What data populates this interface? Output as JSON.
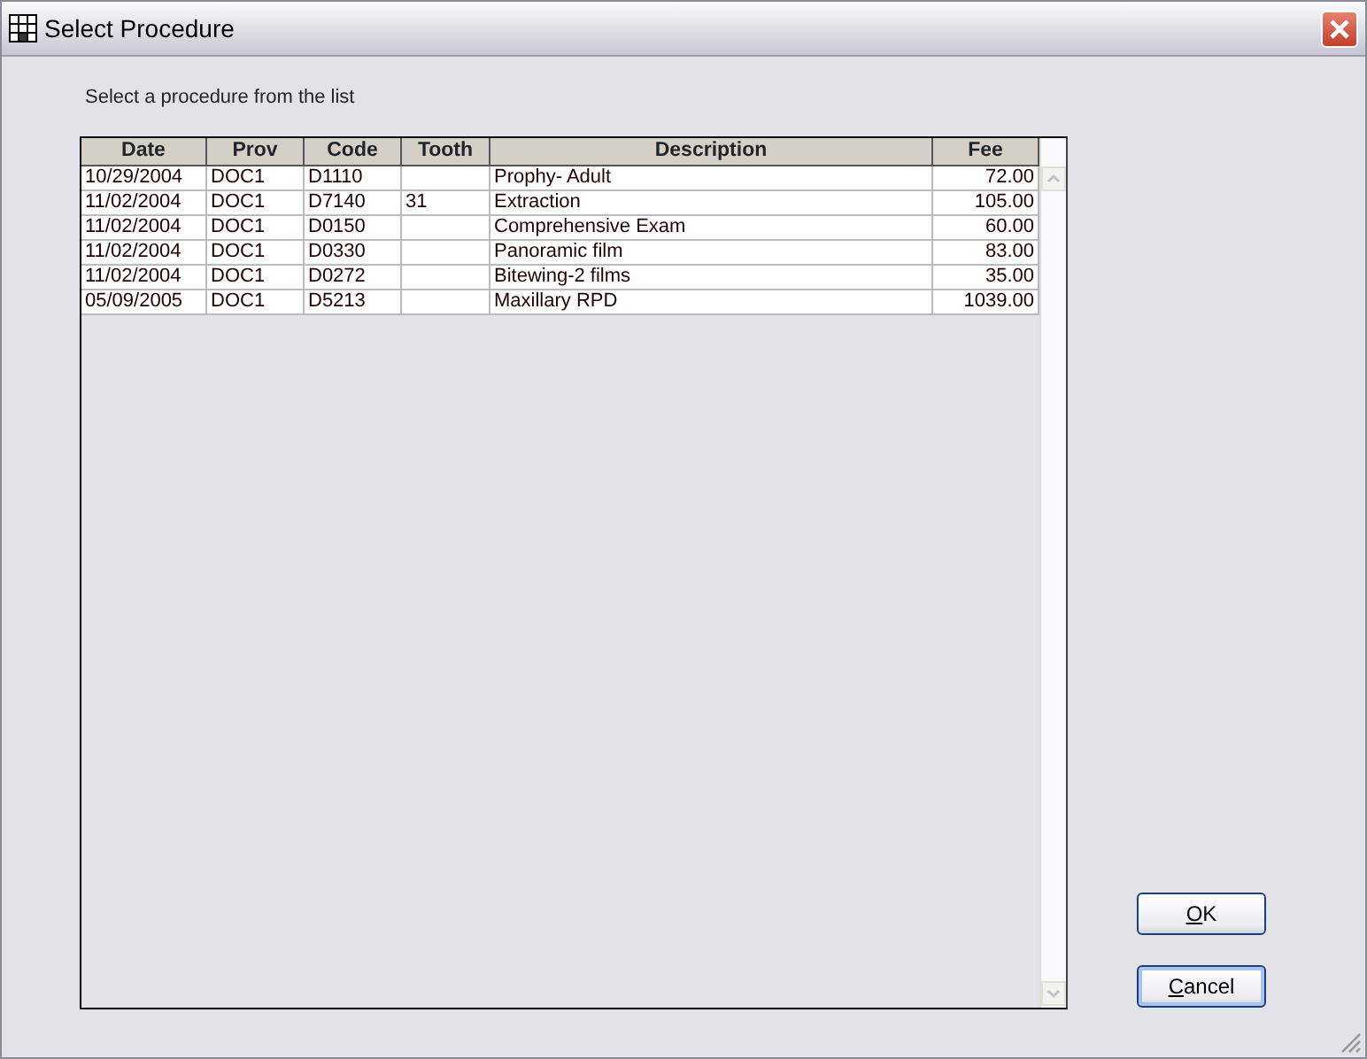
{
  "window": {
    "title": "Select Procedure"
  },
  "prompt": "Select a procedure from the list",
  "table": {
    "columns": [
      "Date",
      "Prov",
      "Code",
      "Tooth",
      "Description",
      "Fee"
    ],
    "rows": [
      [
        "10/29/2004",
        "DOC1",
        "D1110",
        "",
        "Prophy- Adult",
        "72.00"
      ],
      [
        "11/02/2004",
        "DOC1",
        "D7140",
        "31",
        "Extraction",
        "105.00"
      ],
      [
        "11/02/2004",
        "DOC1",
        "D0150",
        "",
        "Comprehensive Exam",
        "60.00"
      ],
      [
        "11/02/2004",
        "DOC1",
        "D0330",
        "",
        "Panoramic film",
        "83.00"
      ],
      [
        "11/02/2004",
        "DOC1",
        "D0272",
        "",
        "Bitewing-2 films",
        "35.00"
      ],
      [
        "05/09/2005",
        "DOC1",
        "D5213",
        "",
        "Maxillary RPD",
        "1039.00"
      ]
    ]
  },
  "buttons": [
    {
      "label": "OK",
      "selected": false
    },
    {
      "label": "Cancel",
      "selected": true
    }
  ]
}
